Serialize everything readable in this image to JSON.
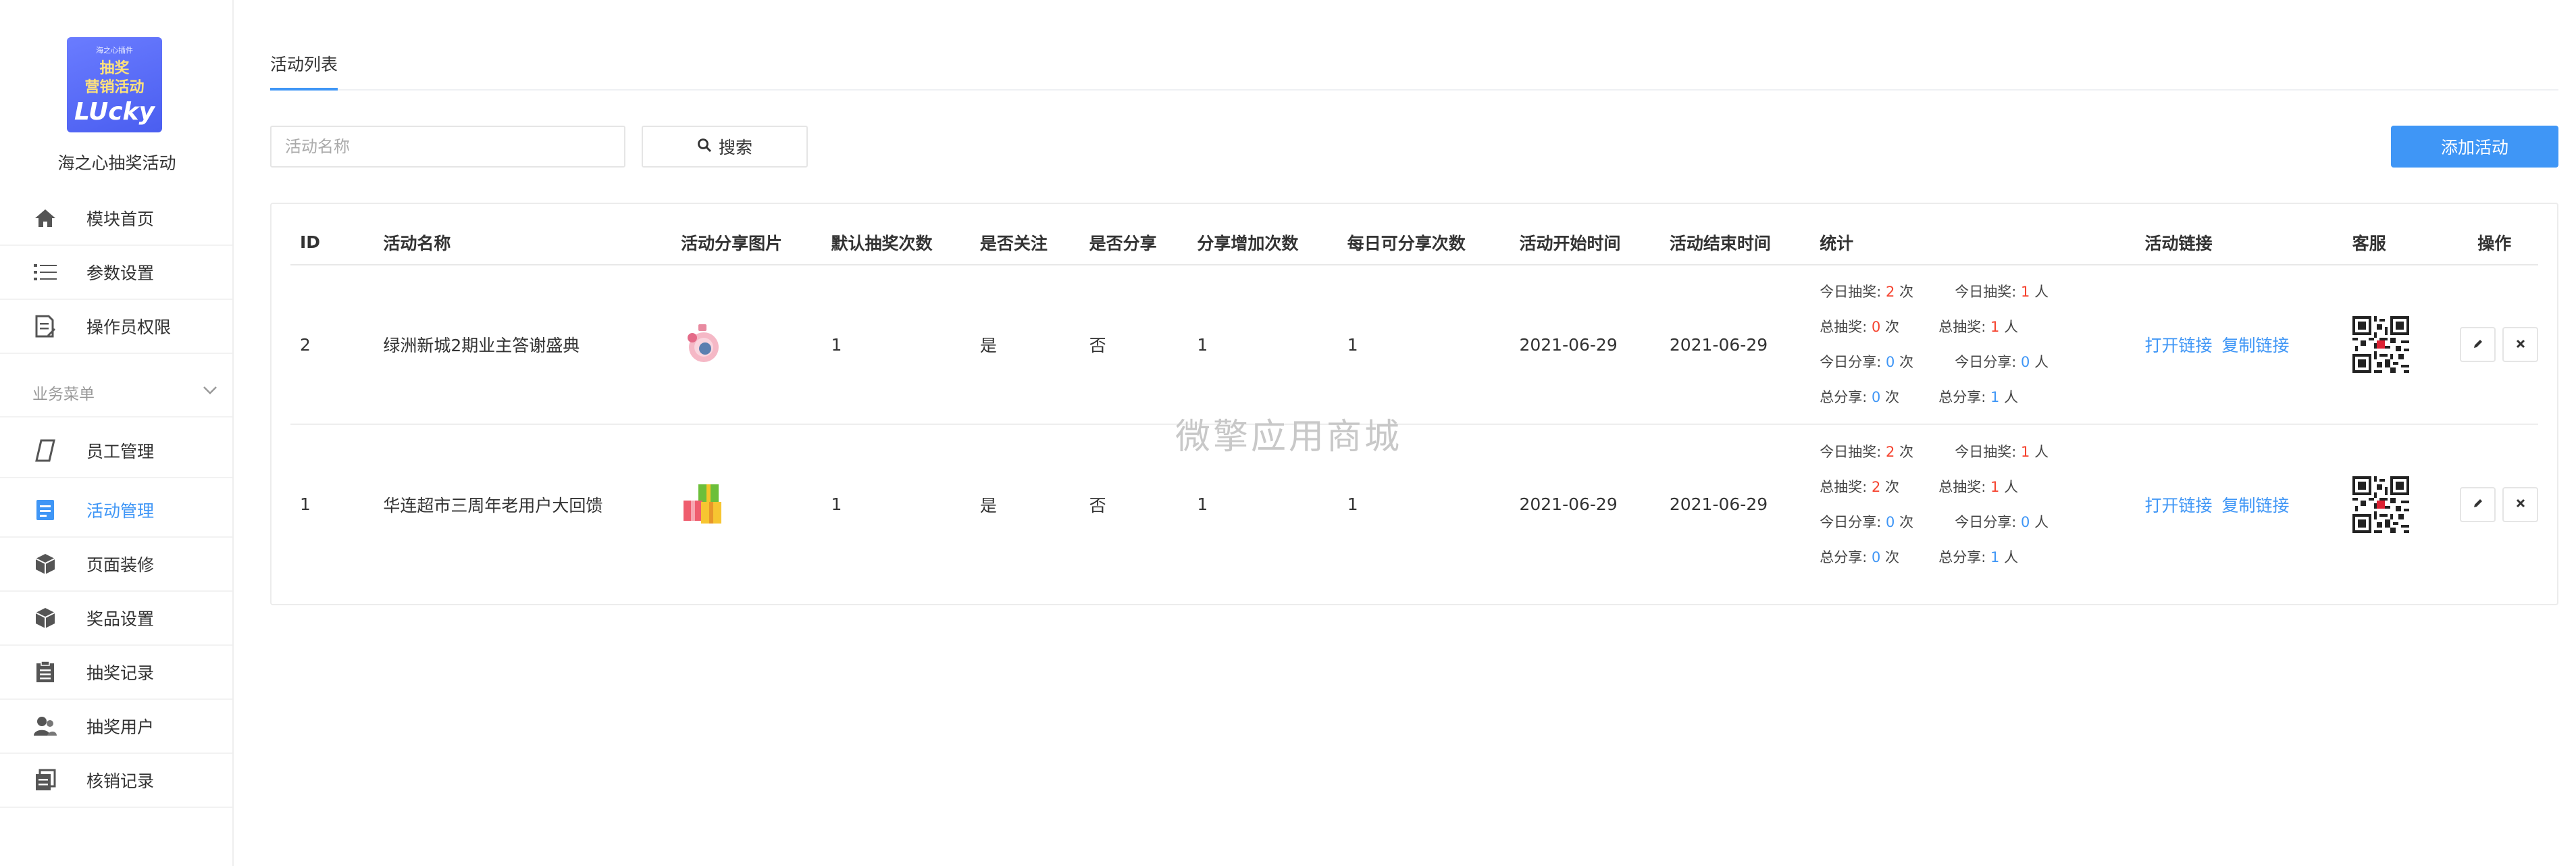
{
  "sidebar": {
    "logo": {
      "small_text": "海之心插件",
      "line1": "抽奖",
      "line2": "营销活动",
      "en": "LUcky"
    },
    "app_name": "海之心抽奖活动",
    "items_top": [
      {
        "label": "模块首页",
        "icon": "home-icon"
      },
      {
        "label": "参数设置",
        "icon": "list-settings-icon"
      },
      {
        "label": "操作员权限",
        "icon": "document-edit-icon"
      }
    ],
    "group_label": "业务菜单",
    "items_business": [
      {
        "label": "员工管理",
        "icon": "staff-icon"
      },
      {
        "label": "活动管理",
        "icon": "activity-icon",
        "active": true
      },
      {
        "label": "页面装修",
        "icon": "cube-icon"
      },
      {
        "label": "奖品设置",
        "icon": "cube-icon"
      },
      {
        "label": "抽奖记录",
        "icon": "clipboard-icon"
      },
      {
        "label": "抽奖用户",
        "icon": "users-icon"
      },
      {
        "label": "核销记录",
        "icon": "copy-icon"
      }
    ]
  },
  "main": {
    "tab_label": "活动列表",
    "search_placeholder": "活动名称",
    "search_button": "搜索",
    "add_button": "添加活动"
  },
  "table": {
    "headers": [
      "ID",
      "活动名称",
      "活动分享图片",
      "默认抽奖次数",
      "是否关注",
      "是否分享",
      "分享增加次数",
      "每日可分享次数",
      "活动开始时间",
      "活动结束时间",
      "统计",
      "活动链接",
      "客服",
      "操作"
    ],
    "stat_labels": {
      "today_draws": "今日抽奖:",
      "total_draws": "总抽奖:",
      "today_shares": "今日分享:",
      "total_shares": "总分享:",
      "unit_times": "次",
      "unit_people": "人"
    },
    "link_open": "打开链接",
    "link_copy": "复制链接",
    "rows": [
      {
        "id": "2",
        "name": "绿洲新城2期业主答谢盛典",
        "image": "perfume-bottle-image",
        "default_draws": "1",
        "follow": "是",
        "share": "否",
        "share_add": "1",
        "daily_shares": "1",
        "start": "2021-06-29",
        "end": "2021-06-29",
        "stats": {
          "today_draw_times": "2",
          "today_draw_people": "1",
          "total_draw_times": "0",
          "total_draw_people": "1",
          "today_share_times": "0",
          "today_share_people": "0",
          "total_share_times": "0",
          "total_share_people": "1"
        }
      },
      {
        "id": "1",
        "name": "华连超市三周年老用户大回馈",
        "image": "gift-boxes-image",
        "default_draws": "1",
        "follow": "是",
        "share": "否",
        "share_add": "1",
        "daily_shares": "1",
        "start": "2021-06-29",
        "end": "2021-06-29",
        "stats": {
          "today_draw_times": "2",
          "today_draw_people": "1",
          "total_draw_times": "2",
          "total_draw_people": "1",
          "today_share_times": "0",
          "today_share_people": "0",
          "total_share_times": "0",
          "total_share_people": "1"
        }
      }
    ]
  },
  "watermark": "微擎应用商城",
  "colors": {
    "accent": "#3f96f6",
    "red": "#f5432f",
    "logo_bg": "#5b6ef6"
  }
}
